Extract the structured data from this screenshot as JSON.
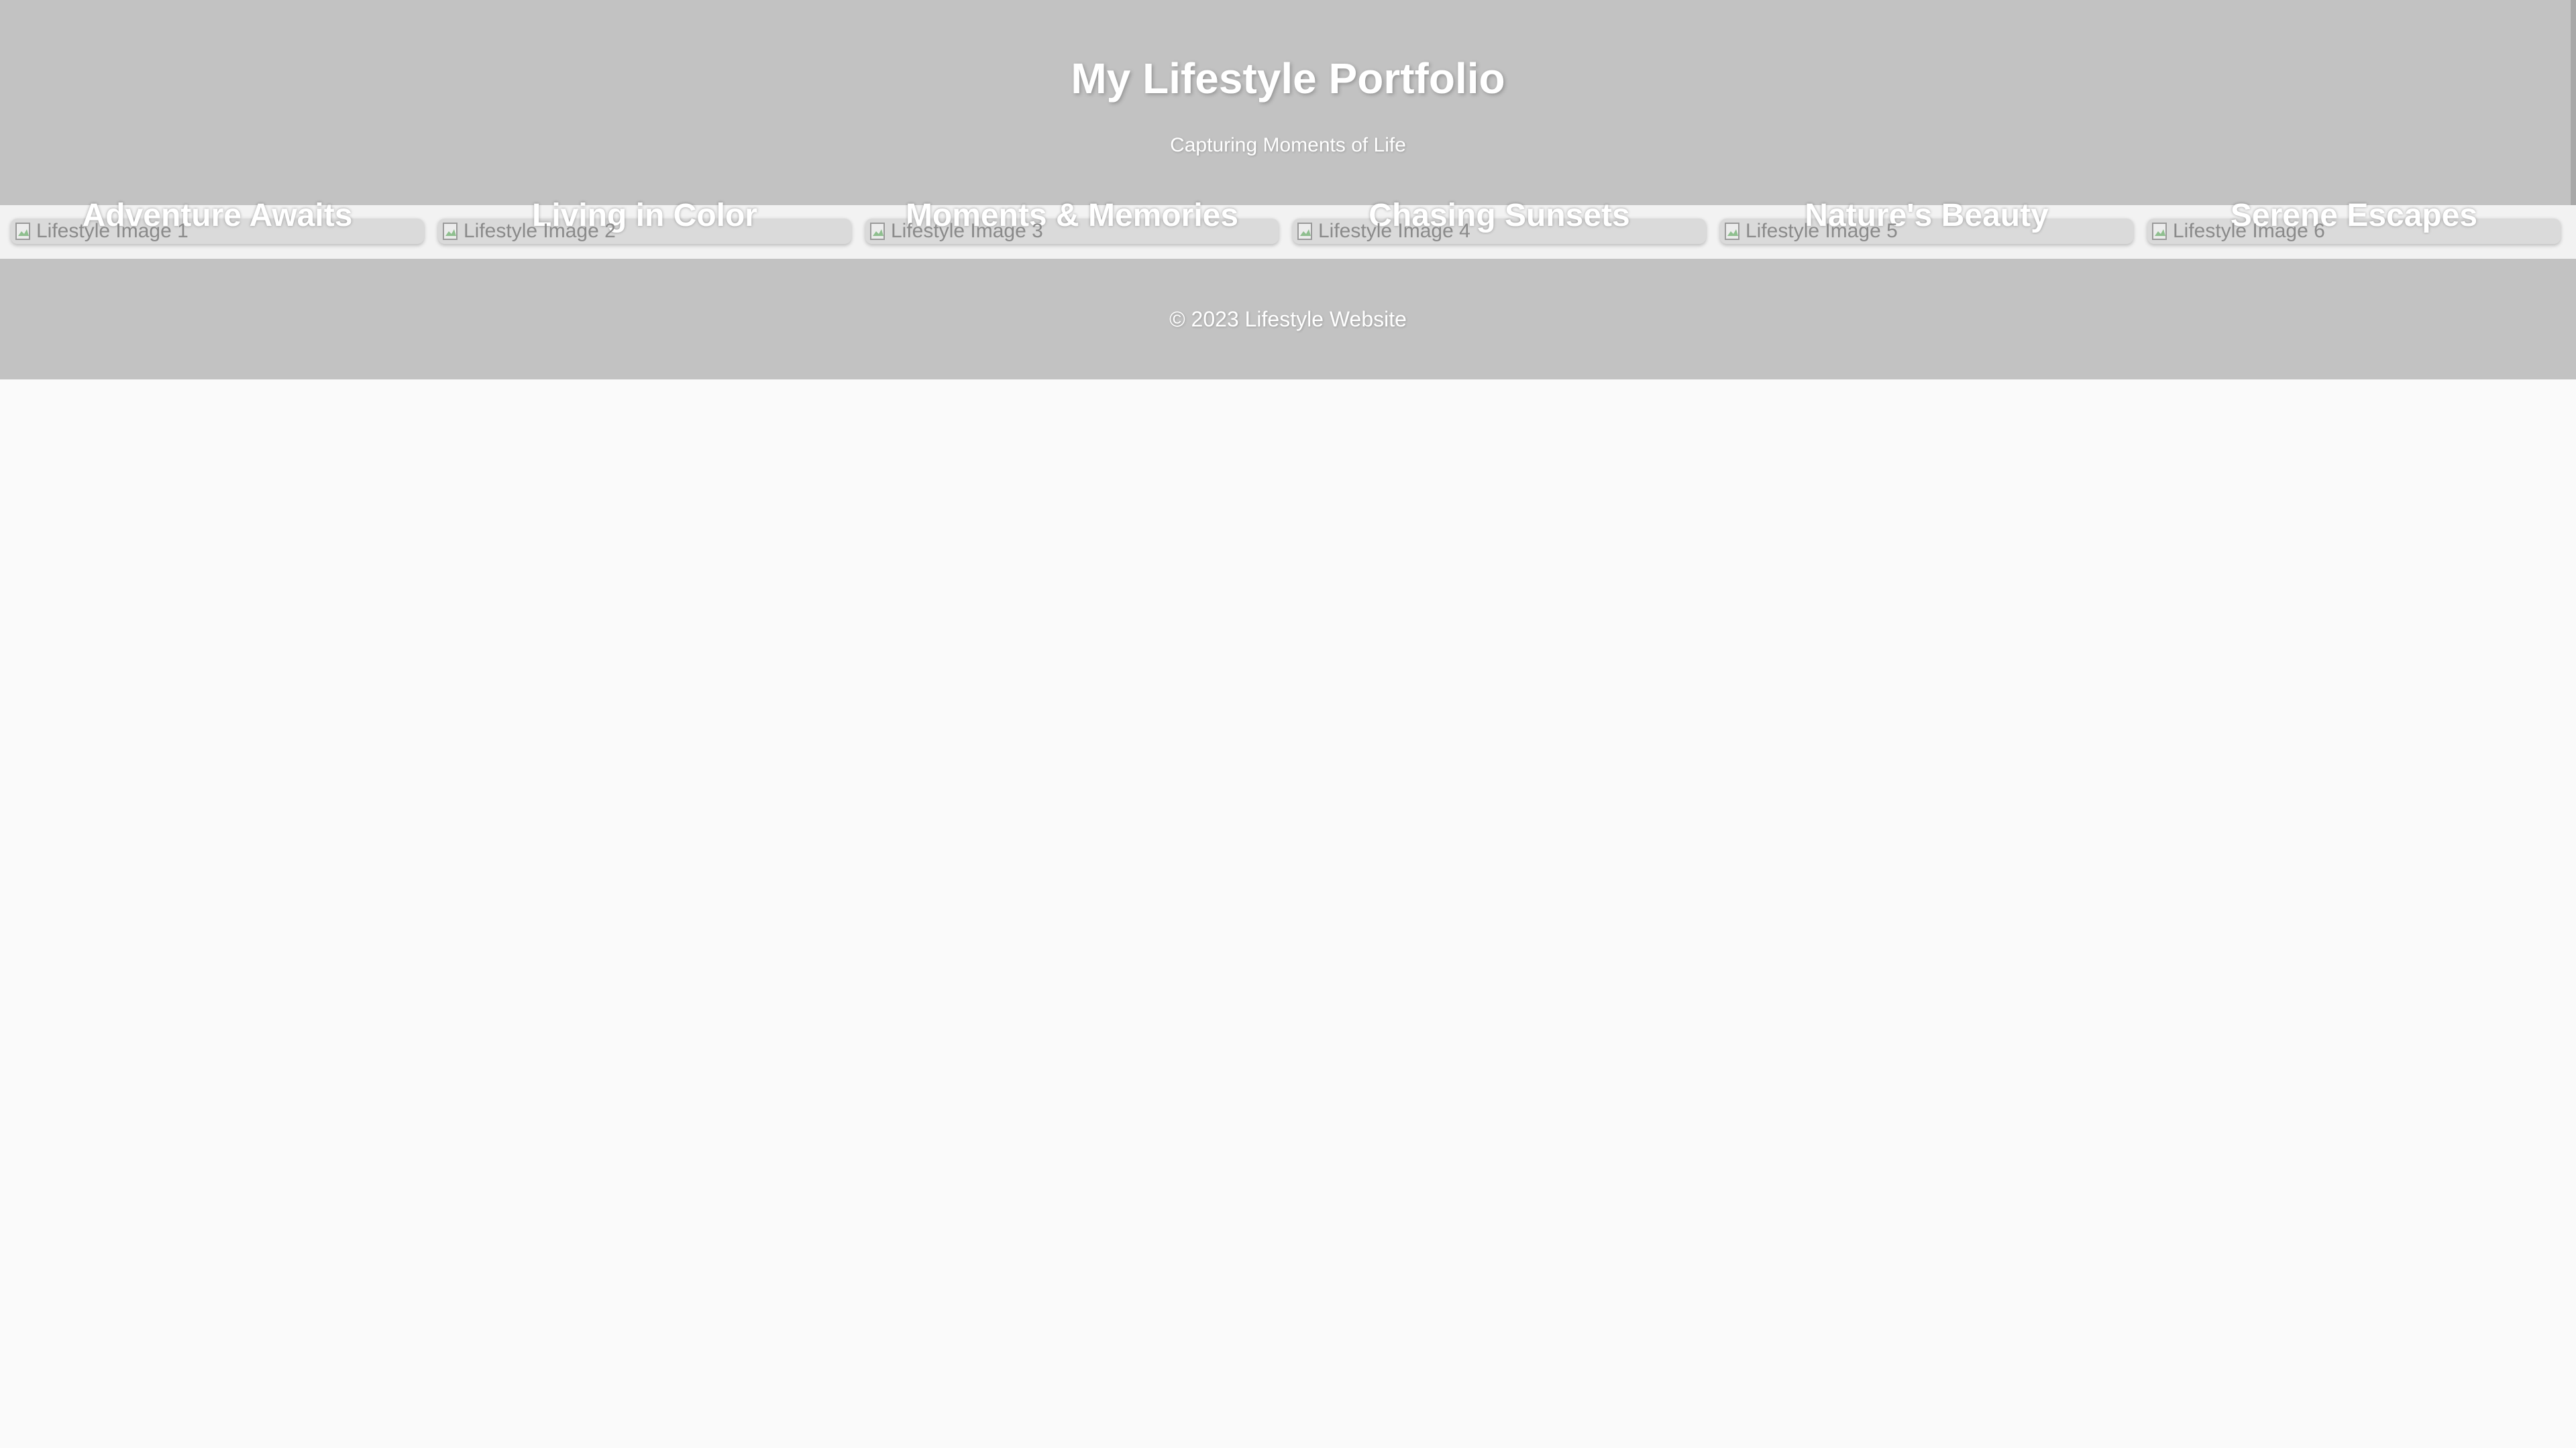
{
  "header": {
    "title": "My Lifestyle Portfolio",
    "subtitle": "Capturing Moments of Life"
  },
  "gallery": {
    "items": [
      {
        "title": "Adventure Awaits",
        "alt": "Lifestyle Image 1"
      },
      {
        "title": "Living in Color",
        "alt": "Lifestyle Image 2"
      },
      {
        "title": "Moments & Memories",
        "alt": "Lifestyle Image 3"
      },
      {
        "title": "Chasing Sunsets",
        "alt": "Lifestyle Image 4"
      },
      {
        "title": "Nature's Beauty",
        "alt": "Lifestyle Image 5"
      },
      {
        "title": "Serene Escapes",
        "alt": "Lifestyle Image 6"
      }
    ]
  },
  "footer": {
    "copyright": "© 2023 Lifestyle Website"
  },
  "icons": {
    "image_placeholder": "broken-image-icon"
  },
  "colors": {
    "header_bg": "#c2c2c2",
    "page_bg": "#fafafa",
    "card_bg": "#dadada",
    "text_light": "#ffffff"
  }
}
